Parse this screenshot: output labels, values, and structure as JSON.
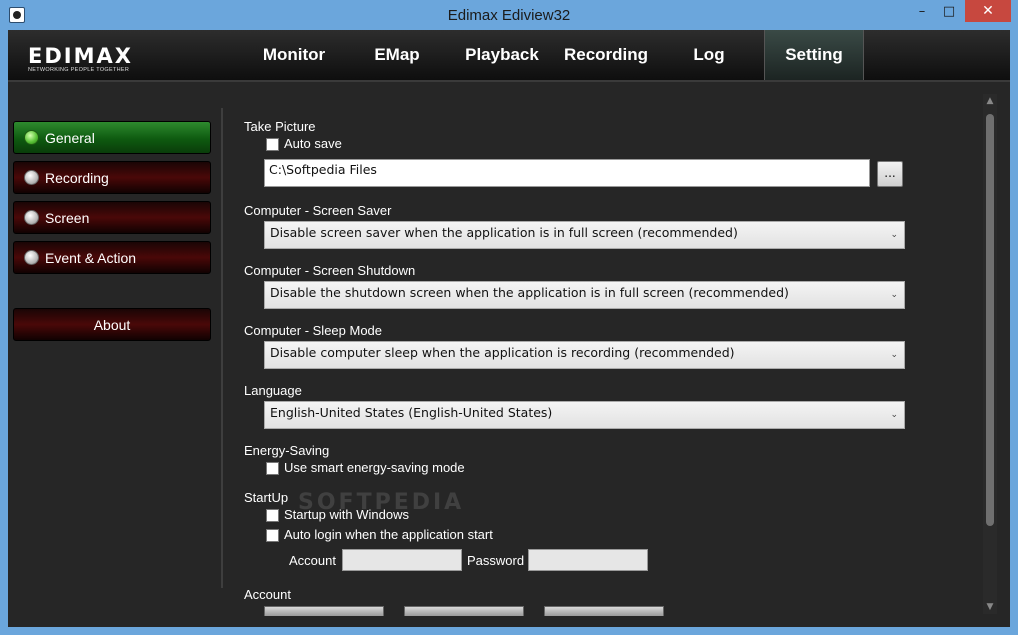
{
  "window": {
    "title": "Edimax Ediview32",
    "minimize": "–",
    "maximize": "□",
    "close": "✕"
  },
  "logo": {
    "main": "EDIMAX",
    "tagline": "NETWORKING PEOPLE TOGETHER"
  },
  "nav": {
    "tabs": [
      {
        "label": "Monitor"
      },
      {
        "label": "EMap"
      },
      {
        "label": "Playback"
      },
      {
        "label": "Recording"
      },
      {
        "label": "Log"
      },
      {
        "label": "Setting",
        "active": true
      }
    ]
  },
  "sidebar": {
    "items": [
      {
        "label": "General",
        "selected": true
      },
      {
        "label": "Recording",
        "selected": false
      },
      {
        "label": "Screen",
        "selected": false
      },
      {
        "label": "Event & Action",
        "selected": false
      },
      {
        "label": "About"
      }
    ]
  },
  "settings": {
    "take_picture": {
      "heading": "Take Picture",
      "auto_save_label": "Auto save",
      "auto_save_checked": false,
      "path_value": "C:\\Softpedia Files",
      "browse_label": "..."
    },
    "screen_saver": {
      "heading": "Computer - Screen Saver",
      "value": "Disable screen saver when the application is in full screen (recommended)"
    },
    "screen_shutdown": {
      "heading": "Computer - Screen Shutdown",
      "value": "Disable the shutdown screen when the application is in full screen (recommended)"
    },
    "sleep_mode": {
      "heading": "Computer - Sleep Mode",
      "value": "Disable computer sleep when the application is recording (recommended)"
    },
    "language": {
      "heading": "Language",
      "value": "English-United States (English-United States)"
    },
    "energy_saving": {
      "heading": "Energy-Saving",
      "option_label": "Use smart energy-saving mode",
      "checked": false
    },
    "startup": {
      "heading": "StartUp",
      "startup_windows_label": "Startup with Windows",
      "startup_windows_checked": false,
      "auto_login_label": "Auto login when the application start",
      "auto_login_checked": false,
      "account_label": "Account",
      "account_value": "",
      "password_label": "Password",
      "password_value": ""
    },
    "account": {
      "heading": "Account"
    }
  },
  "watermark": "SOFTPEDIA",
  "icons": {
    "caret": "chevron-down-icon",
    "scroll_up": "arrow-up-icon",
    "scroll_down": "arrow-down-icon"
  },
  "colors": {
    "active_green": "#0e5a10",
    "inactive_red": "#4a0808",
    "background": "#262626"
  }
}
